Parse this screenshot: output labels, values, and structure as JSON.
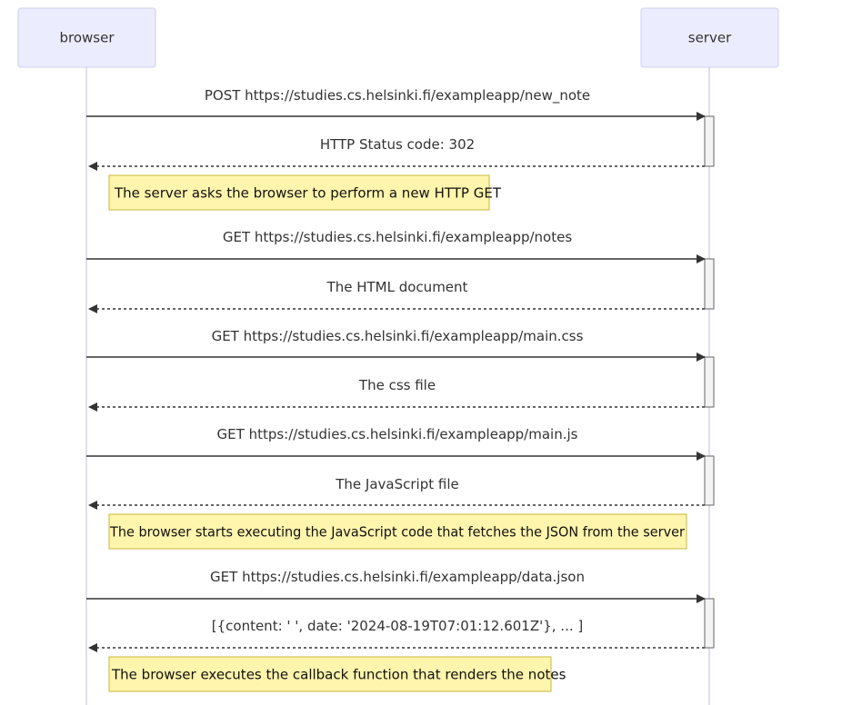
{
  "actors": [
    {
      "id": "browser",
      "label": "browser"
    },
    {
      "id": "server",
      "label": "server"
    }
  ],
  "messages": [
    {
      "from": "browser",
      "to": "server",
      "style": "solid",
      "label": "POST https://studies.cs.helsinki.fi/exampleapp/new_note"
    },
    {
      "from": "server",
      "to": "browser",
      "style": "dashed",
      "label": "HTTP Status code: 302"
    },
    {
      "from": "browser",
      "to": "server",
      "style": "solid",
      "label": "GET https://studies.cs.helsinki.fi/exampleapp/notes"
    },
    {
      "from": "server",
      "to": "browser",
      "style": "dashed",
      "label": "The HTML document"
    },
    {
      "from": "browser",
      "to": "server",
      "style": "solid",
      "label": "GET https://studies.cs.helsinki.fi/exampleapp/main.css"
    },
    {
      "from": "server",
      "to": "browser",
      "style": "dashed",
      "label": "The css file"
    },
    {
      "from": "browser",
      "to": "server",
      "style": "solid",
      "label": "GET https://studies.cs.helsinki.fi/exampleapp/main.js"
    },
    {
      "from": "server",
      "to": "browser",
      "style": "dashed",
      "label": "The JavaScript file"
    },
    {
      "from": "browser",
      "to": "server",
      "style": "solid",
      "label": "GET https://studies.cs.helsinki.fi/exampleapp/data.json"
    },
    {
      "from": "server",
      "to": "browser",
      "style": "dashed",
      "label": "[{content: ' ', date: '2024-08-19T07:01:12.601Z'}, ... ]"
    }
  ],
  "notes": [
    {
      "over": "browser",
      "text": "The server asks the browser to perform a new HTTP GET"
    },
    {
      "over": "browser",
      "text": "The browser starts executing the JavaScript code that fetches the JSON from the server"
    },
    {
      "over": "browser",
      "text": "The browser executes the callback function that renders the notes"
    }
  ],
  "colors": {
    "actor_fill": "#ececff",
    "note_fill": "#fff5ad",
    "line": "#333333"
  }
}
